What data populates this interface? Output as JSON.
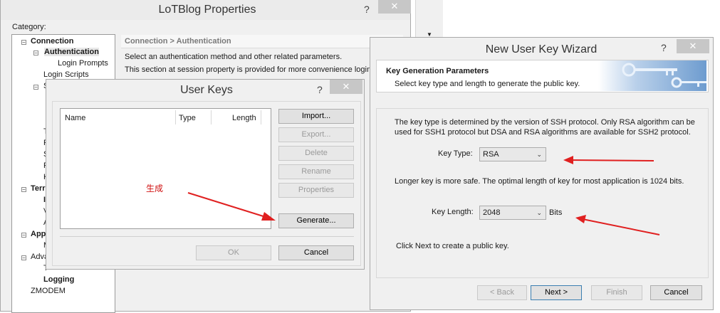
{
  "properties": {
    "title": "LoTBlog Properties",
    "help": "?",
    "close": "✕",
    "category_label": "Category:",
    "tree": [
      {
        "label": "Connection",
        "bold": true
      },
      {
        "label": "Authentication",
        "bold": true
      },
      {
        "label": "Login Prompts",
        "bold": false
      },
      {
        "label": "Login Scripts",
        "bold": false
      },
      {
        "label": "S",
        "bold": false
      },
      {
        "label": "T",
        "bold": false
      },
      {
        "label": "F",
        "bold": false
      },
      {
        "label": "S",
        "bold": false
      },
      {
        "label": "F",
        "bold": false
      },
      {
        "label": "K",
        "bold": false
      },
      {
        "label": "Terr",
        "bold": true
      },
      {
        "label": "I",
        "bold": false
      },
      {
        "label": "V",
        "bold": false
      },
      {
        "label": "A",
        "bold": false
      },
      {
        "label": "App",
        "bold": true
      },
      {
        "label": "M",
        "bold": false
      },
      {
        "label": "Adva",
        "bold": false
      },
      {
        "label": "T",
        "bold": false
      },
      {
        "label": "Logging",
        "bold": true
      },
      {
        "label": "ZMODEM",
        "bold": false
      }
    ],
    "section_header": "Connection > Authentication",
    "desc1": "Select an authentication method and other related parameters.",
    "desc2": "This section at session property is provided for more convenience login"
  },
  "user_keys": {
    "title": "User Keys",
    "help": "?",
    "close": "✕",
    "columns": [
      "Name",
      "Type",
      "Length"
    ],
    "buttons": {
      "import": "Import...",
      "export": "Export...",
      "delete": "Delete",
      "rename": "Rename",
      "properties": "Properties",
      "generate": "Generate...",
      "ok": "OK",
      "cancel": "Cancel"
    },
    "annotation": "生成"
  },
  "wizard": {
    "title": "New User Key Wizard",
    "help": "?",
    "close": "✕",
    "header_title": "Key Generation Parameters",
    "header_sub": "Select key type and length to generate the public key.",
    "para1_line1": "The key type is determined by the version of SSH protocol. Only RSA algorithm can be",
    "para1_line2": "used for SSH1 protocol but DSA and RSA algorithms are available for SSH2 protocol.",
    "key_type_label": "Key Type:",
    "key_type_value": "RSA",
    "para2": "Longer key is more safe. The optimal length of key for most application is 1024 bits.",
    "key_length_label": "Key Length:",
    "key_length_value": "2048",
    "bits_label": "Bits",
    "click_next": "Click Next to create a public key.",
    "buttons": {
      "back": "< Back",
      "next": "Next >",
      "finish": "Finish",
      "cancel": "Cancel"
    }
  },
  "colors": {
    "annotation_red": "#e02020",
    "header_banner": "#6e9ccf"
  }
}
